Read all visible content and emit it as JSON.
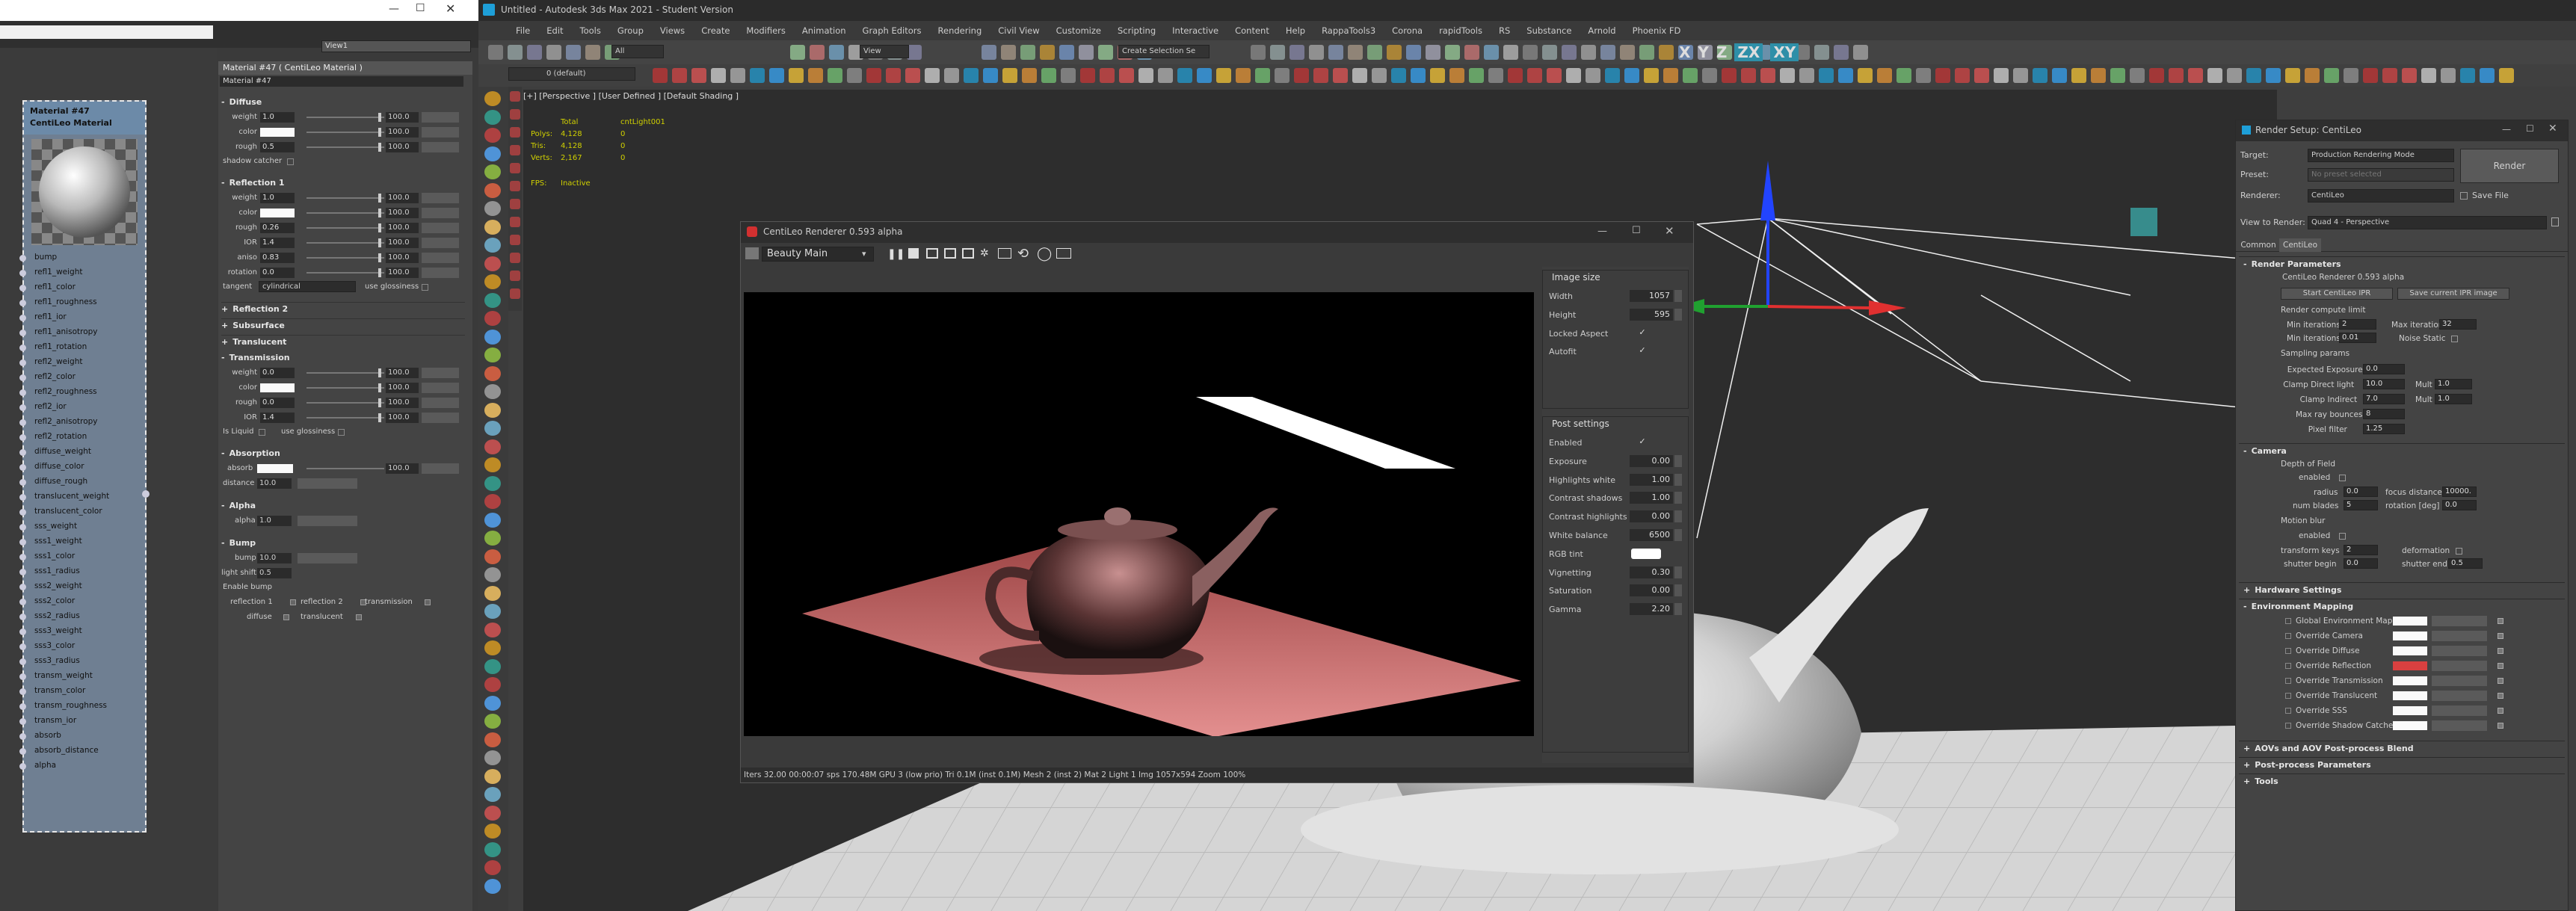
{
  "slate": {
    "view_dropdown": "View1",
    "node": {
      "title_line1": "Material #47",
      "title_line2": "CentiLeo Material"
    },
    "sockets": [
      "bump",
      "refl1_weight",
      "refl1_color",
      "refl1_roughness",
      "refl1_ior",
      "refl1_anisotropy",
      "refl1_rotation",
      "refl2_weight",
      "refl2_color",
      "refl2_roughness",
      "refl2_ior",
      "refl2_anisotropy",
      "refl2_rotation",
      "diffuse_weight",
      "diffuse_color",
      "diffuse_rough",
      "translucent_weight",
      "translucent_color",
      "sss_weight",
      "sss1_weight",
      "sss1_color",
      "sss1_radius",
      "sss2_weight",
      "sss2_color",
      "sss2_radius",
      "sss3_weight",
      "sss3_color",
      "sss3_radius",
      "transm_weight",
      "transm_color",
      "transm_roughness",
      "transm_ior",
      "absorb",
      "absorb_distance",
      "alpha"
    ]
  },
  "props": {
    "header": "Material #47  ( CentiLeo Material )",
    "name_field": "Material #47",
    "diffuse": {
      "title": "Diffuse",
      "rows": [
        {
          "label": "weight",
          "value": "1.0",
          "max": "100.0"
        },
        {
          "label": "color",
          "value": "",
          "max": "100.0"
        },
        {
          "label": "rough",
          "value": "0.5",
          "max": "100.0"
        }
      ],
      "shadow_catcher": "shadow catcher"
    },
    "refl1": {
      "title": "Reflection 1",
      "rows": [
        {
          "label": "weight",
          "value": "1.0",
          "max": "100.0"
        },
        {
          "label": "color",
          "value": "",
          "max": "100.0"
        },
        {
          "label": "rough",
          "value": "0.26",
          "max": "100.0"
        },
        {
          "label": "IOR",
          "value": "1.4",
          "max": "100.0"
        },
        {
          "label": "aniso",
          "value": "0.83",
          "max": "100.0"
        },
        {
          "label": "rotation",
          "value": "0.0",
          "max": "100.0"
        }
      ],
      "tangent_label": "tangent",
      "tangent_value": "cylindrical",
      "use_glossiness": "use glossiness"
    },
    "collapsed": [
      "Reflection 2",
      "Subsurface",
      "Translucent"
    ],
    "transm": {
      "title": "Transmission",
      "rows": [
        {
          "label": "weight",
          "value": "0.0",
          "max": "100.0"
        },
        {
          "label": "color",
          "value": "",
          "max": "100.0"
        },
        {
          "label": "rough",
          "value": "0.0",
          "max": "100.0"
        },
        {
          "label": "IOR",
          "value": "1.4",
          "max": "100.0"
        }
      ],
      "is_liquid": "Is Liquid",
      "use_glossiness": "use glossiness"
    },
    "absorption": {
      "title": "Absorption",
      "absorb_label": "absorb",
      "absorb_max": "100.0",
      "distance_label": "distance",
      "distance_value": "10.0"
    },
    "alpha": {
      "title": "Alpha",
      "label": "alpha",
      "value": "1.0"
    },
    "bump": {
      "title": "Bump",
      "bump_label": "bump",
      "bump_value": "10.0",
      "light_shift_label": "light shift",
      "light_shift_value": "0.5",
      "enable_bump": "Enable bump",
      "flags": [
        "reflection 1",
        "reflection 2",
        "transmission",
        "diffuse",
        "translucent"
      ]
    }
  },
  "max": {
    "title": "Untitled - Autodesk 3ds Max 2021 - Student Version",
    "menu": [
      "File",
      "Edit",
      "Tools",
      "Group",
      "Views",
      "Create",
      "Modifiers",
      "Animation",
      "Graph Editors",
      "Rendering",
      "Civil View",
      "Customize",
      "Scripting",
      "Interactive",
      "Content",
      "Help",
      "RappaTools3",
      "Corona",
      "rapidTools",
      "RS",
      "Substance",
      "Arnold",
      "Phoenix FD"
    ],
    "filter": "All",
    "view_mode": "View",
    "selection_set": "Create Selection Se",
    "layer": "0 (default)",
    "axis_letters": [
      "X",
      "Y",
      "Z",
      "ZX",
      "XY"
    ],
    "viewport_label": "[+] [Perspective ] [User Defined ] [Default Shading ]",
    "stats": {
      "col_total": "Total",
      "col_obj": "cntLight001",
      "rows": [
        {
          "label": "Polys:",
          "total": "4,128",
          "obj": "0"
        },
        {
          "label": "Tris:",
          "total": "4,128",
          "obj": "0"
        },
        {
          "label": "Verts:",
          "total": "2,167",
          "obj": "0"
        }
      ],
      "fps_label": "FPS:",
      "fps_value": "Inactive"
    }
  },
  "centileo": {
    "title": "CentiLeo Renderer 0.593 alpha",
    "dropdown": "Beauty Main",
    "status": "Iters 32.00  00:00:07  sps 170.48M  GPU 3 (low prio)  Tri 0.1M (inst 0.1M)  Mesh 2 (inst 2)  Mat 2  Light 1  Img 1057x594  Zoom 100%",
    "image_size": {
      "title": "Image size",
      "rows": [
        {
          "label": "Width",
          "value": "1057"
        },
        {
          "label": "Height",
          "value": "595"
        },
        {
          "label": "Locked Aspect",
          "value": "✓"
        },
        {
          "label": "Autofit",
          "value": "✓"
        }
      ]
    },
    "post": {
      "title": "Post settings",
      "rows": [
        {
          "label": "Enabled",
          "value": "✓"
        },
        {
          "label": "Exposure",
          "value": "0.00"
        },
        {
          "label": "Highlights white",
          "value": "1.00"
        },
        {
          "label": "Contrast shadows",
          "value": "1.00"
        },
        {
          "label": "Contrast highlights",
          "value": "0.00"
        },
        {
          "label": "White balance",
          "value": "6500"
        },
        {
          "label": "RGB tint",
          "value": ""
        },
        {
          "label": "Vignetting",
          "value": "0.30"
        },
        {
          "label": "Saturation",
          "value": "0.00"
        },
        {
          "label": "Gamma",
          "value": "2.20"
        }
      ]
    }
  },
  "render_setup": {
    "title": "Render Setup: CentiLeo",
    "target_label": "Target:",
    "target_value": "Production Rendering Mode",
    "preset_label": "Preset:",
    "preset_value": "No preset selected",
    "renderer_label": "Renderer:",
    "renderer_value": "CentiLeo",
    "render_btn": "Render",
    "save_file": "Save File",
    "view_label": "View to Render:",
    "view_value": "Quad 4 - Perspective",
    "tabs": [
      "Common",
      "CentiLeo"
    ],
    "params": {
      "title": "Render Parameters",
      "version": "CentiLeo Renderer 0.593 alpha",
      "start_ipr": "Start CentiLeo IPR",
      "save_ipr": "Save current IPR image",
      "compute_limit": "Render compute limit",
      "min_iter_label": "Min iterations",
      "min_iter": "2",
      "max_iter_label": "Max iterations",
      "max_iter": "32",
      "min_iter2_label": "Min iterations",
      "min_iter2": "0.01",
      "noise_static": "Noise Static",
      "sampling": "Sampling params",
      "samp": [
        {
          "label": "Expected Exposure",
          "value": "0.0"
        },
        {
          "label": "Clamp Direct light",
          "value": "10.0",
          "mult": "1.0"
        },
        {
          "label": "Clamp Indirect",
          "value": "7.0",
          "mult": "1.0"
        },
        {
          "label": "Max ray bounces",
          "value": "8"
        },
        {
          "label": "Pixel filter",
          "value": "1.25"
        }
      ],
      "mult_label": "Mult"
    },
    "camera": {
      "title": "Camera",
      "dof": "Depth of Field",
      "enabled": "enabled",
      "radius_label": "radius",
      "radius": "0.0",
      "focus_label": "focus distance",
      "focus": "10000.",
      "blades_label": "num blades",
      "blades": "5",
      "rot_label": "rotation [deg]",
      "rot": "0.0",
      "motion_blur": "Motion blur",
      "mb_enabled": "enabled",
      "keys_label": "transform keys",
      "keys": "2",
      "deform_label": "deformation",
      "shutter_begin_label": "shutter begin",
      "shutter_begin": "0.0",
      "shutter_end_label": "shutter end",
      "shutter_end": "0.5"
    },
    "hardware": "Hardware Settings",
    "env": {
      "title": "Environment Mapping",
      "items": [
        "Global Environment Map",
        "Override Camera",
        "Override Diffuse",
        "Override Reflection",
        "Override Transmission",
        "Override Translucent",
        "Override SSS",
        "Override Shadow Catcher"
      ],
      "highlight_color": "#d94040"
    },
    "more": [
      "AOVs and AOV Post-process Blend",
      "Post-process Parameters",
      "Tools"
    ]
  }
}
